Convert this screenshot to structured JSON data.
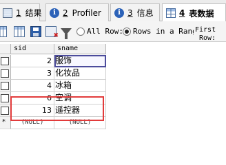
{
  "tabs": [
    {
      "num": "1",
      "label": "结果",
      "icon": "grid-icon",
      "active": false
    },
    {
      "num": "2",
      "label": "Profiler",
      "icon": "info-icon",
      "active": false
    },
    {
      "num": "3",
      "label": "信息",
      "icon": "info-icon",
      "active": false
    },
    {
      "num": "4",
      "label": "表数据",
      "icon": "table-icon",
      "active": true
    }
  ],
  "toolbar": {
    "all_rows_label": "All Row:",
    "rows_in_range_label": "Rows in a Range",
    "rows_in_range_selected": true,
    "first_row_label_line1": "First",
    "first_row_label_line2": "Row:"
  },
  "grid": {
    "columns": [
      "sid",
      "sname"
    ],
    "rows": [
      {
        "sid": "2",
        "sname": "服饰",
        "selected": true
      },
      {
        "sid": "3",
        "sname": "化妆品"
      },
      {
        "sid": "4",
        "sname": "冰箱"
      },
      {
        "sid": "6",
        "sname": "空调"
      },
      {
        "sid": "13",
        "sname": "遥控器"
      }
    ],
    "new_row": {
      "marker": "*",
      "sid": "(NULL)",
      "sname": "(NULL)"
    }
  },
  "colors": {
    "highlight_box": "#e23b3b",
    "selection_outline": "#4c4c9c"
  }
}
